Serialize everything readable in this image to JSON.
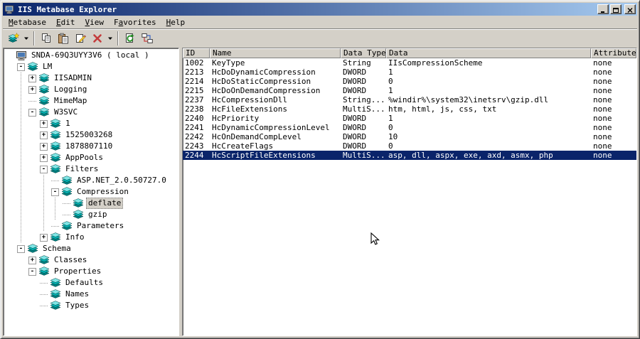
{
  "window": {
    "title": "IIS Metabase Explorer",
    "controls": [
      {
        "name": "minimize-button",
        "icon": "minimize-icon"
      },
      {
        "name": "maximize-button",
        "icon": "maximize-icon"
      },
      {
        "name": "close-button",
        "icon": "close-icon"
      }
    ],
    "app_icon": "app-icon"
  },
  "menu": {
    "items": [
      {
        "label": "Metabase",
        "underline": 0
      },
      {
        "label": "Edit",
        "underline": 0
      },
      {
        "label": "View",
        "underline": 0
      },
      {
        "label": "Favorites",
        "underline": 1
      },
      {
        "label": "Help",
        "underline": 0
      }
    ]
  },
  "toolbar": {
    "buttons": [
      {
        "name": "new-key-button",
        "icon": "new-key-icon"
      },
      {
        "name": "new-key-dropdown",
        "icon": "chevron-down-icon"
      },
      {
        "type": "separator"
      },
      {
        "name": "copy-button",
        "icon": "copy-icon"
      },
      {
        "name": "paste-button",
        "icon": "paste-icon"
      },
      {
        "name": "rename-button",
        "icon": "rename-icon"
      },
      {
        "name": "delete-button",
        "icon": "delete-icon"
      },
      {
        "name": "delete-dropdown",
        "icon": "chevron-down-icon"
      },
      {
        "type": "separator"
      },
      {
        "name": "refresh-button",
        "icon": "refresh-icon"
      },
      {
        "name": "connect-button",
        "icon": "connect-icon"
      }
    ]
  },
  "tree": {
    "nodes": [
      {
        "label": "SNDA-69Q3UYY3V6 ( local )",
        "depth": 0,
        "expander": null,
        "icon": "computer-icon"
      },
      {
        "label": "LM",
        "depth": 1,
        "expander": "-",
        "icon": "metabase-key-icon"
      },
      {
        "label": "IISADMIN",
        "depth": 2,
        "expander": "+",
        "icon": "metabase-key-icon"
      },
      {
        "label": "Logging",
        "depth": 2,
        "expander": "+",
        "icon": "metabase-key-icon"
      },
      {
        "label": "MimeMap",
        "depth": 2,
        "expander": "leaf",
        "icon": "metabase-key-icon"
      },
      {
        "label": "W3SVC",
        "depth": 2,
        "expander": "-",
        "icon": "metabase-key-icon"
      },
      {
        "label": "1",
        "depth": 3,
        "expander": "+",
        "icon": "metabase-key-icon"
      },
      {
        "label": "1525003268",
        "depth": 3,
        "expander": "+",
        "icon": "metabase-key-icon"
      },
      {
        "label": "1878807110",
        "depth": 3,
        "expander": "+",
        "icon": "metabase-key-icon"
      },
      {
        "label": "AppPools",
        "depth": 3,
        "expander": "+",
        "icon": "metabase-key-icon"
      },
      {
        "label": "Filters",
        "depth": 3,
        "expander": "-",
        "icon": "metabase-key-icon"
      },
      {
        "label": "ASP.NET_2.0.50727.0",
        "depth": 4,
        "expander": "leaf",
        "icon": "metabase-key-icon"
      },
      {
        "label": "Compression",
        "depth": 4,
        "expander": "-",
        "icon": "metabase-key-icon"
      },
      {
        "label": "deflate",
        "depth": 5,
        "expander": "leaf",
        "icon": "metabase-key-icon",
        "selected": true
      },
      {
        "label": "gzip",
        "depth": 5,
        "expander": "leaf",
        "icon": "metabase-key-icon"
      },
      {
        "label": "Parameters",
        "depth": 4,
        "expander": "leaf",
        "icon": "metabase-key-icon"
      },
      {
        "label": "Info",
        "depth": 3,
        "expander": "+",
        "icon": "metabase-key-icon"
      },
      {
        "label": "Schema",
        "depth": 1,
        "expander": "-",
        "icon": "metabase-key-icon"
      },
      {
        "label": "Classes",
        "depth": 2,
        "expander": "+",
        "icon": "metabase-key-icon"
      },
      {
        "label": "Properties",
        "depth": 2,
        "expander": "-",
        "icon": "metabase-key-icon"
      },
      {
        "label": "Defaults",
        "depth": 3,
        "expander": "leaf",
        "icon": "metabase-key-icon"
      },
      {
        "label": "Names",
        "depth": 3,
        "expander": "leaf",
        "icon": "metabase-key-icon"
      },
      {
        "label": "Types",
        "depth": 3,
        "expander": "leaf",
        "icon": "metabase-key-icon"
      }
    ]
  },
  "list": {
    "columns": [
      "ID",
      "Name",
      "Data Type",
      "Data",
      "Attributes"
    ],
    "rows": [
      [
        "1002",
        "KeyType",
        "String",
        "IIsCompressionScheme",
        "none"
      ],
      [
        "2213",
        "HcDoDynamicCompression",
        "DWORD",
        "1",
        "none"
      ],
      [
        "2214",
        "HcDoStaticCompression",
        "DWORD",
        "0",
        "none"
      ],
      [
        "2215",
        "HcDoOnDemandCompression",
        "DWORD",
        "1",
        "none"
      ],
      [
        "2237",
        "HcCompressionDll",
        "String...",
        "%windir%\\system32\\inetsrv\\gzip.dll",
        "none"
      ],
      [
        "2238",
        "HcFileExtensions",
        "MultiS...",
        "htm, html, js, css, txt",
        "none"
      ],
      [
        "2240",
        "HcPriority",
        "DWORD",
        "1",
        "none"
      ],
      [
        "2241",
        "HcDynamicCompressionLevel",
        "DWORD",
        "0",
        "none"
      ],
      [
        "2242",
        "HcOnDemandCompLevel",
        "DWORD",
        "10",
        "none"
      ],
      [
        "2243",
        "HcCreateFlags",
        "DWORD",
        "0",
        "none"
      ],
      [
        "2244",
        "HcScriptFileExtensions",
        "MultiS...",
        "asp, dll, aspx, exe, axd, asmx, php",
        "none"
      ]
    ],
    "selected_row_index": 10
  },
  "colors": {
    "titlebar_start": "#0a246a",
    "titlebar_end": "#a6caf0",
    "chrome": "#d4d0c8",
    "selection": "#0a246a",
    "icon_teal": "#00b2b2"
  }
}
